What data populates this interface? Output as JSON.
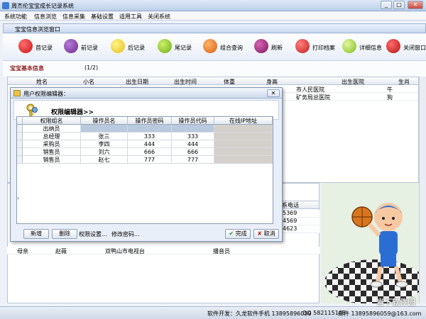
{
  "app": {
    "title": "周杰伦宝宝成长记录系统"
  },
  "window_controls": {
    "minimize": "_",
    "maximize": "□",
    "close": "✕"
  },
  "menu": [
    "系统功能",
    "信息浏览",
    "信息采集",
    "基础设置",
    "适用工具",
    "关闭系统"
  ],
  "inner_window": {
    "title": "宝宝信息浏览窗口"
  },
  "toolbar": [
    {
      "label": "首记录",
      "icon": "cherry-icon",
      "color": "#c8171b"
    },
    {
      "label": "前记录",
      "icon": "plum-icon",
      "color": "#6a2b8e"
    },
    {
      "label": "后记录",
      "icon": "lemon-icon",
      "color": "#f2d21a"
    },
    {
      "label": "尾记录",
      "icon": "lime-icon",
      "color": "#7fc11b"
    },
    {
      "label": "组合查询",
      "icon": "orange-icon",
      "color": "#e8731a"
    },
    {
      "label": "刷新",
      "icon": "mulberry-icon",
      "color": "#8b1f6e"
    },
    {
      "label": "打印档案",
      "icon": "strawberry-icon",
      "color": "#d72a2a"
    },
    {
      "label": "详细信息",
      "icon": "green-apple-icon",
      "color": "#8ecb2c"
    },
    {
      "label": "关闭窗口",
      "icon": "red-apple-icon",
      "color": "#cf1f1f"
    }
  ],
  "section": {
    "title": "宝宝基本信息",
    "page": "(1/2)"
  },
  "grid": {
    "columns": [
      "姓名",
      "小名",
      "出生日期",
      "出生时间",
      "体重",
      "身高",
      "",
      "出生医院",
      "生肖"
    ],
    "rows": [
      {
        "hospital": "市人民医院",
        "zodiac": "牛"
      },
      {
        "hospital": "矿务局总医院",
        "zodiac": "狗"
      }
    ]
  },
  "contacts": {
    "header": "系电话",
    "phones": [
      "5369",
      "4569",
      "4623"
    ],
    "lower_rows": [
      {
        "relation": "母亲",
        "name": "赵薇",
        "address": "双鸭山市电视台",
        "job": "播音员"
      }
    ]
  },
  "status": {
    "developer": "软件开发：久龙软件",
    "phone": "手机 13895896059",
    "qq": "QQ 582115148",
    "email": "邮件 13895896059@163.com"
  },
  "dialog": {
    "title": "用户权限编辑器：",
    "close": "✕",
    "heading": "权限编辑器>>",
    "columns": [
      "权限组名",
      "操作员名",
      "操作员密码",
      "操作员代码",
      "在线IP地址"
    ],
    "rows": [
      {
        "group": "出纳员",
        "name": "",
        "password": "",
        "code": "",
        "ip": ""
      },
      {
        "group": "总经理",
        "name": "张三",
        "password": "333",
        "code": "333",
        "ip": ""
      },
      {
        "group": "采购员",
        "name": "李四",
        "password": "444",
        "code": "444",
        "ip": ""
      },
      {
        "group": "销售员",
        "name": "刘六",
        "password": "666",
        "code": "666",
        "ip": ""
      },
      {
        "group": "销售员",
        "name": "赵七",
        "password": "777",
        "code": "777",
        "ip": ""
      }
    ],
    "buttons": {
      "add": "新增",
      "delete": "删除",
      "perm": "权限设置...",
      "pwd": "修改密码...",
      "ok": "完成",
      "cancel": "取消"
    },
    "ok_mark": "✔",
    "cancel_mark": "✘"
  },
  "watermark": "当下软件园"
}
